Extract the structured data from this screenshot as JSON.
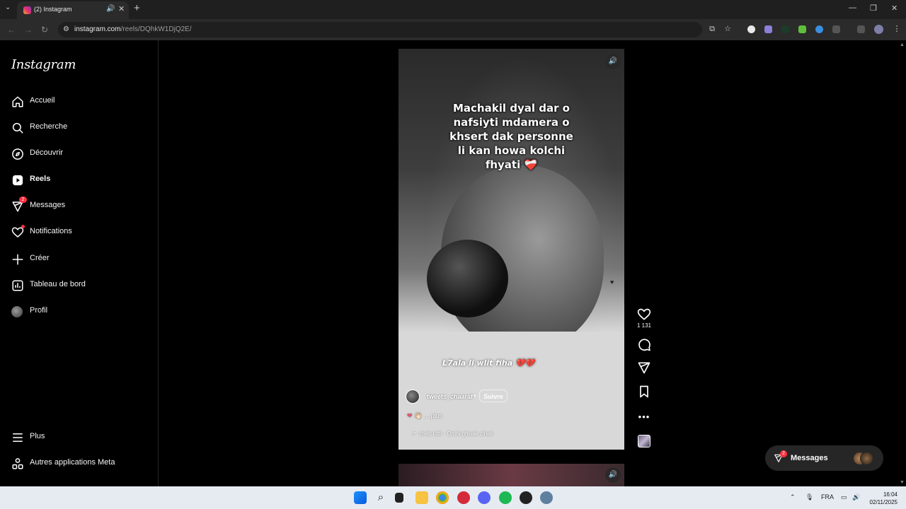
{
  "browser": {
    "tab_title": "(2) Instagram",
    "url_host": "instagram.com",
    "url_path": "/reels/DQhkW1DjQ2E/"
  },
  "sidebar": {
    "logo": "Instagram",
    "items": [
      {
        "label": "Accueil",
        "icon": "home-icon"
      },
      {
        "label": "Recherche",
        "icon": "search-icon"
      },
      {
        "label": "Découvrir",
        "icon": "compass-icon"
      },
      {
        "label": "Reels",
        "icon": "reels-icon"
      },
      {
        "label": "Messages",
        "icon": "messenger-icon",
        "badge": "2"
      },
      {
        "label": "Notifications",
        "icon": "heart-icon"
      },
      {
        "label": "Créer",
        "icon": "plus-icon"
      },
      {
        "label": "Tableau de bord",
        "icon": "dashboard-icon"
      },
      {
        "label": "Profil",
        "icon": "avatar"
      }
    ],
    "bottom": [
      {
        "label": "Plus",
        "icon": "menu-icon"
      },
      {
        "label": "Autres applications Meta",
        "icon": "meta-apps-icon"
      }
    ]
  },
  "reel": {
    "caption_lines": [
      "Machakil dyal dar o",
      "nafsiyti mdamera o",
      "khsert dak personne",
      "li kan howa kolchi",
      "fhyati ❤️‍🩹"
    ],
    "subtext": "L7ala li wlit fiha 💔💔",
    "author": "tweets_chaaraf",
    "separator": "•",
    "follow_label": "Suivre",
    "desc_more": "... plus",
    "audio": "cheb lotfi · Omrii ghwak zinek"
  },
  "actions": {
    "likes": "1 131"
  },
  "messages_pill": {
    "label": "Messages",
    "badge": "2"
  },
  "taskbar": {
    "lang": "FRA",
    "time": "16:04",
    "date": "02/11/2025"
  },
  "colors": {
    "accent_badge": "#ff3040",
    "background": "#000000"
  }
}
